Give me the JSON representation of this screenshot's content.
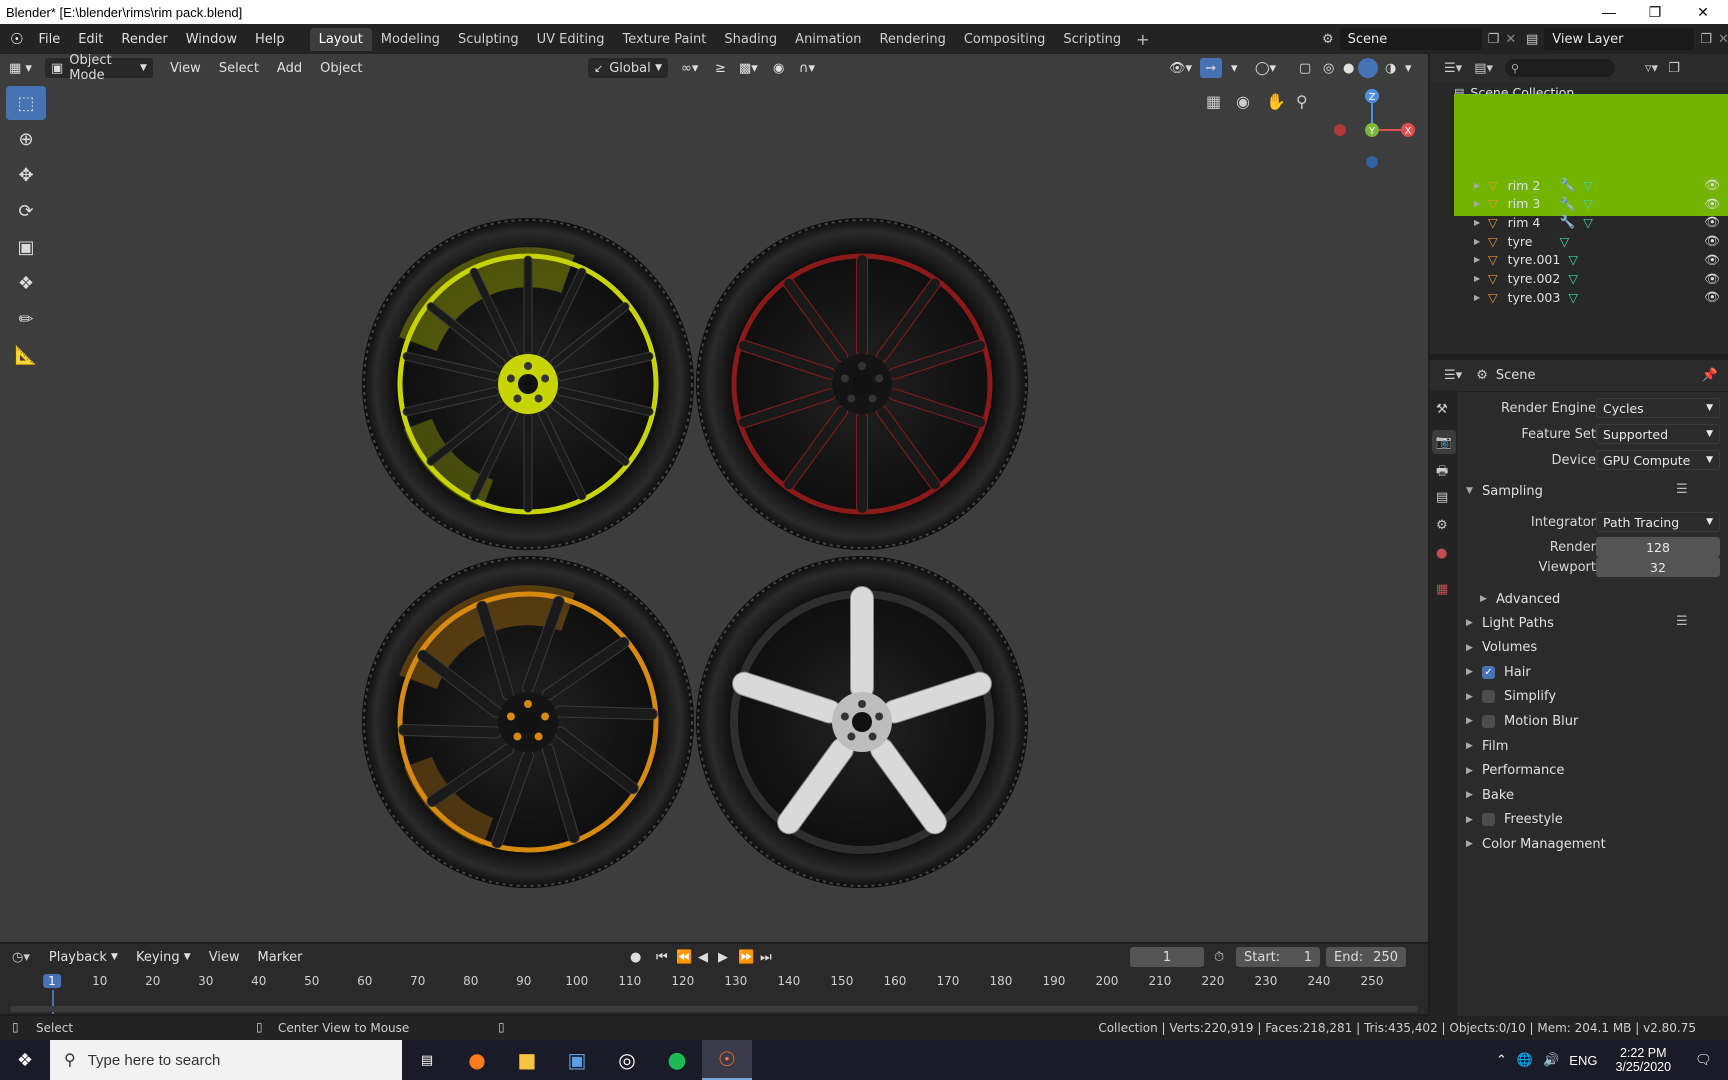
{
  "window": {
    "title": "Blender* [E:\\blender\\rims\\rim pack.blend]"
  },
  "menu": [
    "File",
    "Edit",
    "Render",
    "Window",
    "Help"
  ],
  "workspaces": [
    {
      "label": "Layout",
      "active": true
    },
    {
      "label": "Modeling"
    },
    {
      "label": "Sculpting"
    },
    {
      "label": "UV Editing"
    },
    {
      "label": "Texture Paint"
    },
    {
      "label": "Shading"
    },
    {
      "label": "Animation"
    },
    {
      "label": "Rendering"
    },
    {
      "label": "Compositing"
    },
    {
      "label": "Scripting"
    }
  ],
  "scene_field": "Scene",
  "view_layer_field": "View Layer",
  "viewport_header": {
    "mode": "Object Mode",
    "menus": [
      "View",
      "Select",
      "Add",
      "Object"
    ],
    "transform_orientation": "Global"
  },
  "gizmo": {
    "z": "Z",
    "y": "Y",
    "x": "X"
  },
  "outliner": {
    "root": "Scene Collection",
    "items": [
      {
        "name": "rim 2",
        "has_modifier": true
      },
      {
        "name": "rim 3",
        "has_modifier": true
      },
      {
        "name": "rim 4",
        "has_modifier": true
      },
      {
        "name": "tyre",
        "has_modifier": false
      },
      {
        "name": "tyre.001",
        "has_modifier": false
      },
      {
        "name": "tyre.002",
        "has_modifier": false
      },
      {
        "name": "tyre.003",
        "has_modifier": false
      }
    ],
    "overlay_color": "#73b400"
  },
  "properties": {
    "context": "Scene",
    "render_engine_label": "Render Engine",
    "render_engine": "Cycles",
    "feature_set_label": "Feature Set",
    "feature_set": "Supported",
    "device_label": "Device",
    "device": "GPU Compute",
    "sampling": "Sampling",
    "integrator_label": "Integrator",
    "integrator": "Path Tracing",
    "render_label": "Render",
    "render": "128",
    "viewport_label": "Viewport",
    "viewport": "32",
    "advanced": "Advanced",
    "panels": [
      {
        "label": "Light Paths",
        "checkbox": null,
        "list": true
      },
      {
        "label": "Volumes",
        "checkbox": null
      },
      {
        "label": "Hair",
        "checkbox": true
      },
      {
        "label": "Simplify",
        "checkbox": false
      },
      {
        "label": "Motion Blur",
        "checkbox": false
      },
      {
        "label": "Film",
        "checkbox": null
      },
      {
        "label": "Performance",
        "checkbox": null
      },
      {
        "label": "Bake",
        "checkbox": null
      },
      {
        "label": "Freestyle",
        "checkbox": false
      },
      {
        "label": "Color Management",
        "checkbox": null
      }
    ]
  },
  "timeline": {
    "menus": [
      "Playback",
      "Keying",
      "View",
      "Marker"
    ],
    "current_frame": "1",
    "start_label": "Start:",
    "start": "1",
    "end_label": "End:",
    "end": "250",
    "ticks": [
      "1",
      "10",
      "20",
      "30",
      "40",
      "50",
      "60",
      "70",
      "80",
      "90",
      "100",
      "110",
      "120",
      "130",
      "140",
      "150",
      "160",
      "170",
      "180",
      "190",
      "200",
      "210",
      "220",
      "230",
      "240",
      "250"
    ]
  },
  "statusbar": {
    "left": "Select",
    "middle": "Center View to Mouse",
    "right": "Collection | Verts:220,919 | Faces:218,281 | Tris:435,402 | Objects:0/10 | Mem: 204.1 MB | v2.80.75"
  },
  "taskbar": {
    "search_placeholder": "Type here to search",
    "lang": "ENG",
    "time": "2:22 PM",
    "date": "3/25/2020"
  },
  "wheels": [
    {
      "accent": "#c8d400",
      "spokes": 14,
      "style": "mesh"
    },
    {
      "accent": "#8a1a1a",
      "spokes": 10,
      "style": "y-split"
    },
    {
      "accent": "#d78a10",
      "spokes": 10,
      "style": "curved"
    },
    {
      "accent": "#cfcfcf",
      "spokes": 5,
      "style": "silver"
    }
  ]
}
